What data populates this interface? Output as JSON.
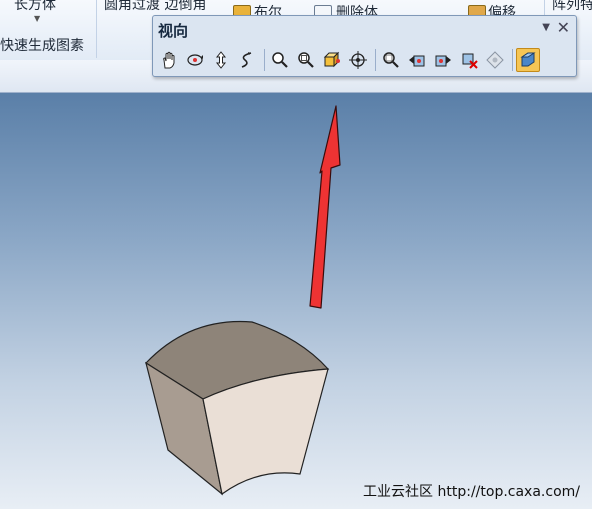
{
  "ribbon": {
    "group1_top_label": "长方体",
    "group1_bottom_label": "快速生成图素",
    "group2_line1": "圆角过渡  边倒角",
    "bool_label": "布尔",
    "remove_label": "删除体",
    "offset_label": "偏移",
    "array_label": "阵列特"
  },
  "toolbar": {
    "title": "视向",
    "buttons": [
      "pan-icon",
      "orbit-icon",
      "dynamic-rotate-icon",
      "walk-icon",
      "zoom-icon",
      "zoom-window-icon",
      "view-box-icon",
      "focus-target-icon",
      "zoom-fit-icon",
      "previous-view-icon",
      "next-view-icon",
      "clear-view-icon",
      "view-direction-icon",
      "active-view-icon"
    ]
  },
  "viewport": {
    "watermark": "工业云社区 http://top.caxa.com/"
  },
  "colors": {
    "arrow": "#ee3333",
    "solid_front": "#eadfd6",
    "solid_side": "#a89c91",
    "solid_top": "#8e8479",
    "toolbar_bg": "#dbe5f1",
    "active_button": "#f5c555"
  }
}
